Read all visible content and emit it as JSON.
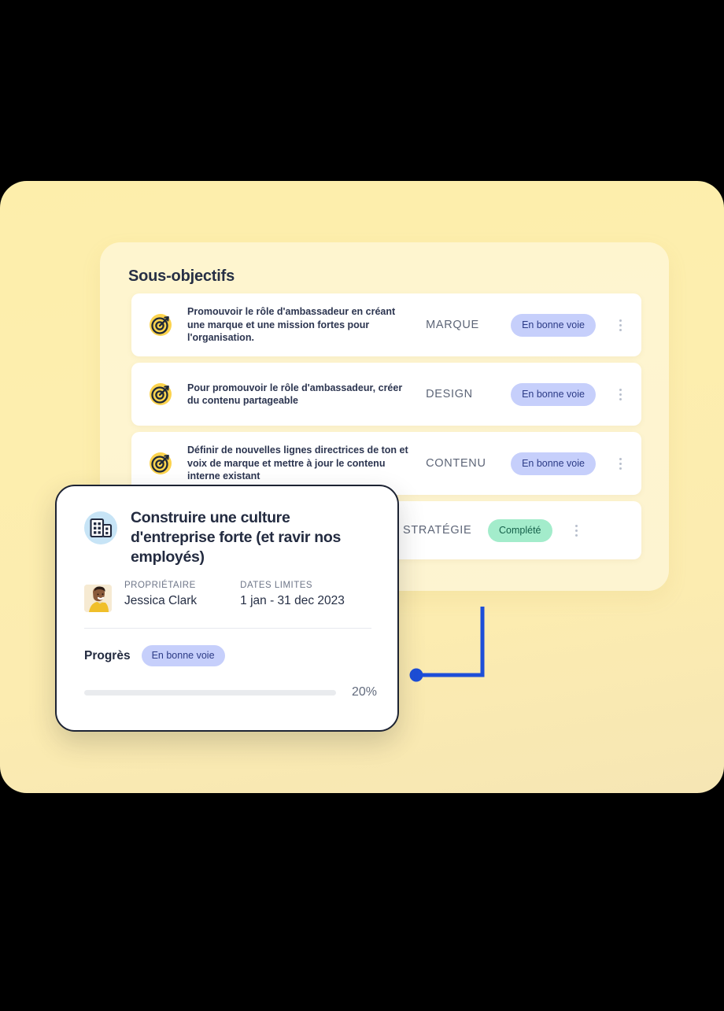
{
  "panel": {
    "title": "Sous-objectifs",
    "background_color": "#fdeeae",
    "inner_panel_color": "rgba(255,255,255,0.42)"
  },
  "rows": [
    {
      "icon": "target-icon",
      "text": "Promouvoir le rôle d'ambassadeur en créant une marque et une mission fortes pour l'organisation.",
      "category": "MARQUE",
      "status": "En bonne voie",
      "status_kind": "blue",
      "menu": "kebab-menu-icon"
    },
    {
      "icon": "target-icon",
      "text": "Pour promouvoir le rôle d'ambassadeur, créer du contenu partageable",
      "category": "DESIGN",
      "status": "En bonne voie",
      "status_kind": "blue",
      "menu": "kebab-menu-icon"
    },
    {
      "icon": "target-icon",
      "text": "Définir de nouvelles lignes directrices de ton et voix de marque et mettre à jour le contenu interne existant",
      "category": "CONTENU",
      "status": "En bonne voie",
      "status_kind": "blue",
      "menu": "kebab-menu-icon"
    },
    {
      "icon": "target-icon",
      "text": "",
      "category": "STRATÉGIE",
      "status": "Complété",
      "status_kind": "green",
      "menu": "kebab-menu-icon"
    }
  ],
  "popup": {
    "icon": "building-icon",
    "title": "Construire une culture d'entreprise forte (et ravir nos employés)",
    "owner_label": "PROPRIÉTAIRE",
    "owner_name": "Jessica Clark",
    "dates_label": "DATES LIMITES",
    "dates_value": "1 jan - 31 dec 2023",
    "progress_label": "Progrès",
    "progress_status": "En bonne voie",
    "progress_percent": "20%",
    "progress_value": 20
  },
  "colors": {
    "badge_blue_bg": "#c6cffb",
    "badge_blue_text": "#2c3b86",
    "badge_green_bg": "#a3eccb",
    "badge_green_text": "#15604a",
    "progress_fill": "#4871f7",
    "connector": "#1d4ed8",
    "panel_yellow": "#fdeeae"
  }
}
